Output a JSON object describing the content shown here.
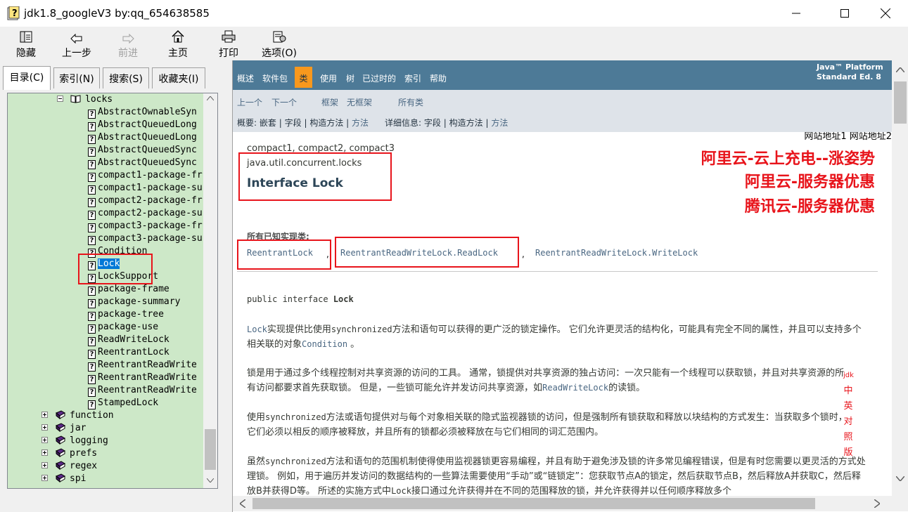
{
  "window": {
    "title": "jdk1.8_googleV3 by:qq_654638585"
  },
  "toolbar": {
    "hide": "隐藏",
    "back": "上一步",
    "forward": "前进",
    "home": "主页",
    "print": "打印",
    "options": "选项(O)"
  },
  "tabs": [
    "目录(C)",
    "索引(N)",
    "搜索(S)",
    "收藏夹(I)"
  ],
  "tree": {
    "folder": "locks",
    "items": [
      "AbstractOwnableSyn",
      "AbstractQueuedLong",
      "AbstractQueuedLong",
      "AbstractQueuedSync",
      "AbstractQueuedSync",
      "compact1-package-fr",
      "compact1-package-su",
      "compact2-package-fr",
      "compact2-package-su",
      "compact3-package-fr",
      "compact3-package-su",
      "Condition",
      "Lock",
      "LockSupport",
      "package-frame",
      "package-summary",
      "package-tree",
      "package-use",
      "ReadWriteLock",
      "ReentrantLock",
      "ReentrantReadWrite",
      "ReentrantReadWrite",
      "ReentrantReadWrite",
      "StampedLock"
    ],
    "selected": "Lock",
    "packages": [
      "function",
      "jar",
      "logging",
      "prefs",
      "regex",
      "spi"
    ]
  },
  "nav": {
    "top": [
      "概述",
      "软件包",
      "类",
      "使用",
      "树",
      "已过时的",
      "索引",
      "帮助"
    ],
    "current": "类",
    "about_line1": "Java™ Platform",
    "about_line2": "Standard Ed. 8",
    "prev": "上一个",
    "next": "下一个",
    "frames": "框架",
    "noframes": "无框架",
    "allclasses": "所有类",
    "summary_label": "概要:",
    "summary_nested": "嵌套",
    "summary_field": "字段",
    "summary_constr": "构造方法",
    "summary_method": "方法",
    "detail_label": "详细信息:",
    "detail_field": "字段",
    "detail_constr": "构造方法",
    "detail_method": "方法",
    "sep": "|"
  },
  "content": {
    "site_links": "网站地址1 网站地址2",
    "ad1": "阿里云-云上充电--涨姿势",
    "ad2": "阿里云-服务器优惠",
    "ad3": "腾讯云-服务器优惠",
    "profiles": "compact1, compact2, compact3",
    "package": "java.util.concurrent.locks",
    "title": "Interface Lock",
    "impl_label": "所有已知实现类:",
    "impl1": "ReentrantLock",
    "impl2": "ReentrantReadWriteLock.ReadLock",
    "impl3": "ReentrantReadWriteLock.WriteLock",
    "comma": ",",
    "decl_prefix": "public interface ",
    "decl_name": "Lock",
    "p1": {
      "a": "Lock",
      "b": "实现提供比使用",
      "c": "synchronized",
      "d": "方法和语句可以获得的更广泛的锁定操作。 它们允许更灵活的结构化，可能具有完全不同的属性，并且可以支持多个相关联的对象",
      "e": "Condition",
      "f": " 。"
    },
    "p2": {
      "a": "锁是用于通过多个线程控制对共享资源的访问的工具。 通常，锁提供对共享资源的独占访问：一次只能有一个线程可以获取锁，并且对共享资源的所有访问都要求首先获取锁。 但是，一些锁可能允许并发访问共享资源，如",
      "b": "ReadWriteLock",
      "c": "的读锁。"
    },
    "p3": {
      "a": "使用",
      "b": "synchronized",
      "c": "方法或语句提供对与每个对象相关联的隐式监视器锁的访问，但是强制所有锁获取和释放以块结构的方式发生：当获取多个锁时，它们必须以相反的顺序被释放，并且所有的锁都必须被释放在与它们相同的词汇范围内。"
    },
    "p4": {
      "a": "虽然",
      "b": "synchronized",
      "c": "方法和语句的范围机制使得使用监视器锁更容易编程，并且有助于避免涉及锁的许多常见编程错误，但是有时您需要以更灵活的方式处理锁。 例如，用于遍历并发访问的数据结构的一些算法需要使用“手动”或“链锁定”：您获取节点A的锁定，然后获取节点B，然后释放A并获取C，然后释放B并获得D等。 所述的实施方式中",
      "d": "Lock",
      "e": "接口通过允许获得并在不同的范围释放的锁，并允许获得并以任何顺序释放多个"
    },
    "vertical_tag": [
      "jdk",
      "中",
      "英",
      "对",
      "照",
      "版"
    ]
  },
  "colors": {
    "nav_bg": "#4d7a97",
    "nav_current": "#f8981d",
    "subnav_bg": "#dee3e9",
    "tree_bg": "#cde8c8",
    "annotation_red": "#e8141b",
    "link": "#4a6782"
  }
}
